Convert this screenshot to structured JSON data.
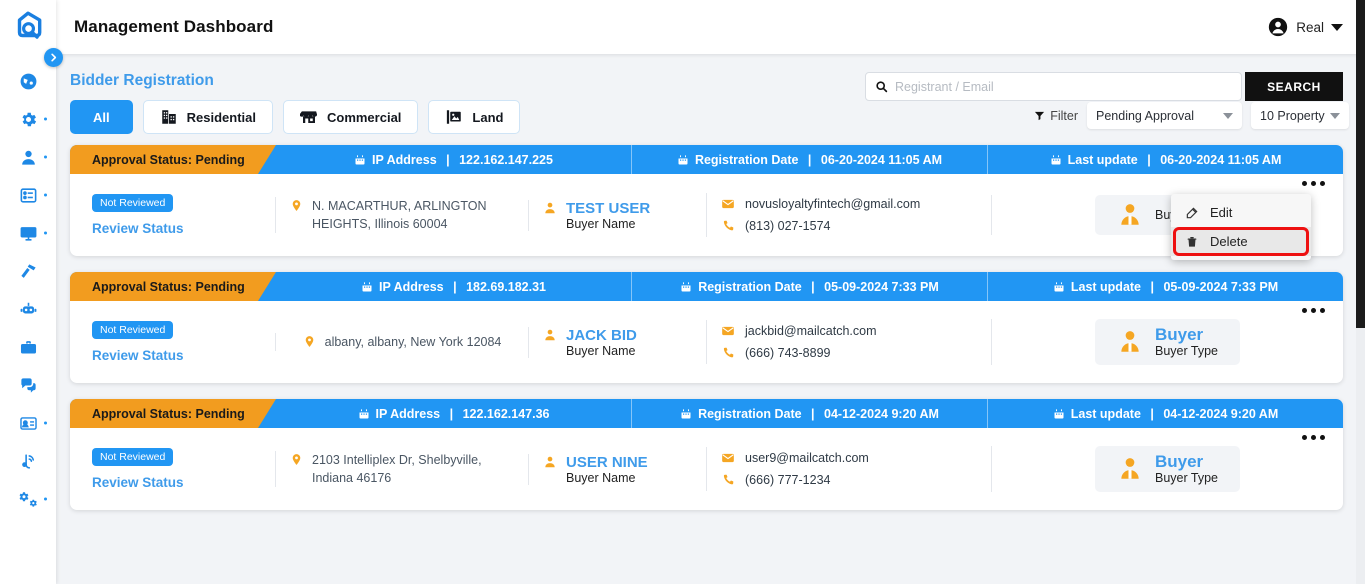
{
  "app": {
    "logo_icon": "house-search-logo",
    "title": "Management Dashboard"
  },
  "topbar": {
    "profile_icon": "account-circle-icon",
    "profile_name": "Real",
    "caret_icon": "chevron-down-icon"
  },
  "sidebar": {
    "collapse_icon": "chevron-right-circle-icon",
    "items": [
      {
        "icon": "dashboard-globe-icon",
        "dot": false
      },
      {
        "icon": "gear-icon",
        "dot": true
      },
      {
        "icon": "user-icon",
        "dot": true
      },
      {
        "icon": "list-icon",
        "dot": true
      },
      {
        "icon": "monitor-icon",
        "dot": true
      },
      {
        "icon": "hammer-icon",
        "dot": false
      },
      {
        "icon": "robot-icon",
        "dot": false
      },
      {
        "icon": "briefcase-icon",
        "dot": false
      },
      {
        "icon": "chat-bubbles-icon",
        "dot": false
      },
      {
        "icon": "id-card-icon",
        "dot": true
      },
      {
        "icon": "broadcast-icon",
        "dot": false
      },
      {
        "icon": "settings-gears-icon",
        "dot": true
      }
    ]
  },
  "section": {
    "title": "Bidder Registration"
  },
  "search": {
    "icon": "search-icon",
    "placeholder": "Registrant / Email",
    "value": "",
    "button_label": "SEARCH"
  },
  "tabs": [
    {
      "label": "All",
      "icon": "",
      "active": true
    },
    {
      "label": "Residential",
      "icon": "building-icon",
      "active": false
    },
    {
      "label": "Commercial",
      "icon": "shop-icon",
      "active": false
    },
    {
      "label": "Land",
      "icon": "land-survey-icon",
      "active": false
    }
  ],
  "filters": {
    "icon": "funnel-icon",
    "label": "Filter",
    "status_dropdown": "Pending Approval",
    "count_dropdown": "10 Property"
  },
  "table_headers": {
    "ip_label": "IP Address",
    "registration_label": "Registration Date",
    "lastupdate_label": "Last update",
    "calendar_icon": "calendar-icon"
  },
  "labels": {
    "review_status": "Review Status",
    "buyer_name": "Buyer Name",
    "buyer_type": "Buyer Type"
  },
  "menu": {
    "edit_label": "Edit",
    "edit_icon": "edit-pencil-icon",
    "delete_label": "Delete",
    "delete_icon": "trash-icon",
    "highlight_color": "#ee1111"
  },
  "colors": {
    "accent_blue": "#2196f3",
    "status_orange": "#f29c1f",
    "link_blue": "#3f9bea",
    "icon_orange": "#f5a623",
    "search_button": "#111111"
  },
  "rows": [
    {
      "approval_status": "Approval Status: Pending",
      "ip": "122.162.147.225",
      "registration_date": "06-20-2024 11:05 AM",
      "last_update": "06-20-2024 11:05 AM",
      "badge": "Not Reviewed",
      "address": "N. MACARTHUR, ARLINGTON HEIGHTS, Illinois 60004",
      "name": "TEST USER",
      "email": "novusloyaltyfintech@gmail.com",
      "phone": "(813) 027-1574",
      "buyer_type": "",
      "menu_open": true
    },
    {
      "approval_status": "Approval Status: Pending",
      "ip": "182.69.182.31",
      "registration_date": "05-09-2024 7:33 PM",
      "last_update": "05-09-2024 7:33 PM",
      "badge": "Not Reviewed",
      "address": "albany, albany, New York 12084",
      "name": "JACK BID",
      "email": "jackbid@mailcatch.com",
      "phone": "(666) 743-8899",
      "buyer_type": "Buyer",
      "menu_open": false
    },
    {
      "approval_status": "Approval Status: Pending",
      "ip": "122.162.147.36",
      "registration_date": "04-12-2024 9:20 AM",
      "last_update": "04-12-2024 9:20 AM",
      "badge": "Not Reviewed",
      "address": "2103 Intelliplex Dr, Shelbyville, Indiana 46176",
      "name": "USER NINE",
      "email": "user9@mailcatch.com",
      "phone": "(666) 777-1234",
      "buyer_type": "Buyer",
      "menu_open": false
    }
  ]
}
